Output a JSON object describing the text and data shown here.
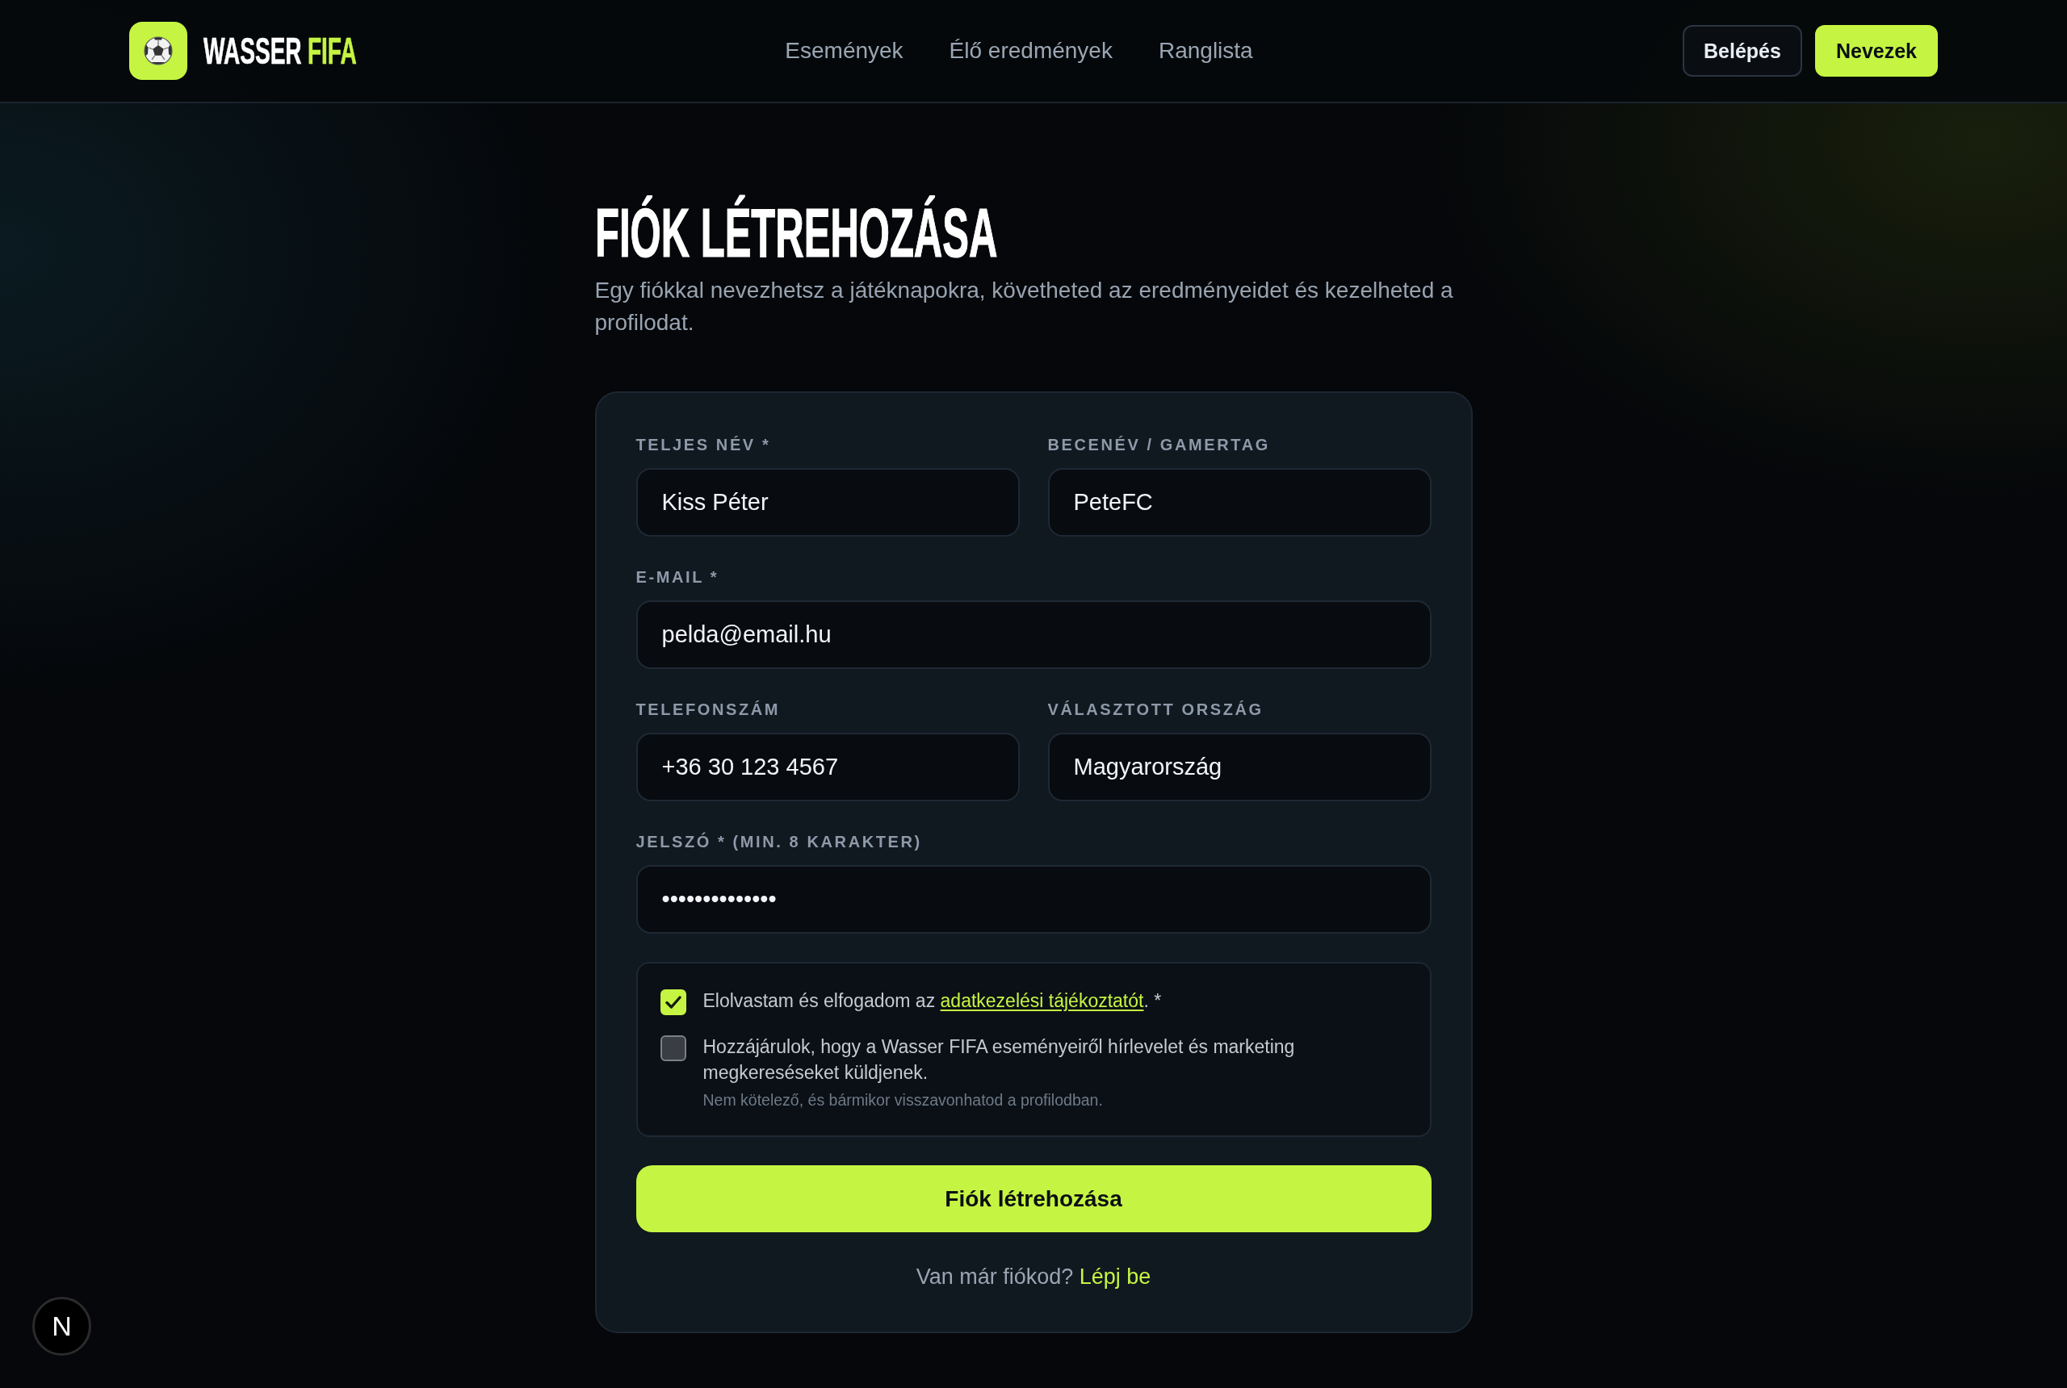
{
  "header": {
    "logo": {
      "text": "WASSER",
      "accent": "FIFA"
    },
    "nav": [
      {
        "label": "Események"
      },
      {
        "label": "Élő eredmények"
      },
      {
        "label": "Ranglista"
      }
    ],
    "actions": [
      {
        "label": "Belépés",
        "kind": "outline"
      },
      {
        "label": "Nevezek",
        "kind": "primary"
      }
    ]
  },
  "intro": {
    "title": "FIÓK LÉTREHOZÁSA",
    "subtitle": "Egy fiókkal nevezhetsz a játéknapokra, követheted az eredményeidet és kezelheted a profilodat."
  },
  "form": {
    "rows": [
      {
        "fields": [
          {
            "label": "TELJES NÉV *",
            "value": "Kiss Péter"
          },
          {
            "label": "BECENÉV / GAMERTAG",
            "value": "PeteFC"
          }
        ]
      },
      {
        "fields": [
          {
            "label": "E-MAIL *",
            "value": "pelda@email.hu"
          }
        ]
      },
      {
        "fields": [
          {
            "label": "TELEFONSZÁM",
            "value": "+36 30 123 4567"
          },
          {
            "label": "VÁLASZTOTT ORSZÁG",
            "value": "Magyarország"
          }
        ]
      },
      {
        "fields": [
          {
            "label": "JELSZÓ * (MIN. 8 KARAKTER)",
            "value": "••••••••••••••"
          }
        ]
      }
    ],
    "consents": [
      {
        "checked": true,
        "text": "Elolvastam és elfogadom az",
        "link": "adatkezelési tájékoztatót",
        "text_after": ". *"
      },
      {
        "checked": false,
        "text": "Hozzájárulok, hogy a Wasser FIFA eseményeiről hírlevelet és marketing megkereséseket küldjenek.",
        "note": "Nem kötelező, és bármikor visszavonhatod a profilodban."
      }
    ],
    "submit": "Fiók létrehozása",
    "footer": {
      "prompt": "Van már fiókod?",
      "link": "Lépj be"
    }
  },
  "dev_badge": {
    "label": "N"
  }
}
